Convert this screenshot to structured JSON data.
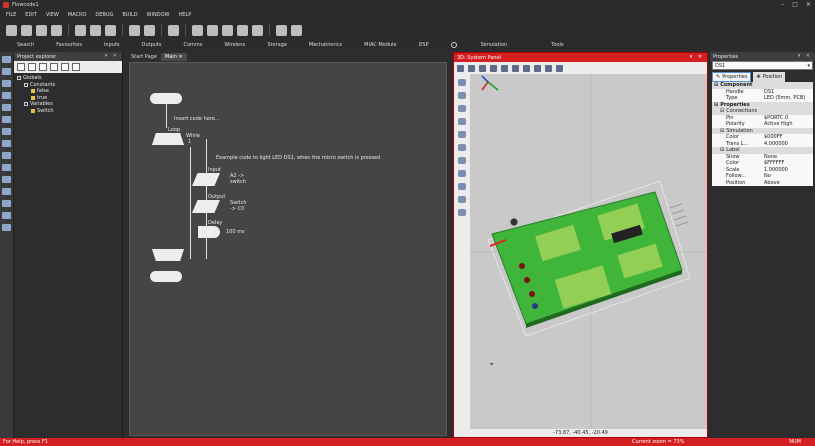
{
  "app": {
    "title": "Flowcode1"
  },
  "menu": [
    "FILE",
    "EDIT",
    "VIEW",
    "MACRO",
    "DEBUG",
    "BUILD",
    "WINDOW",
    "HELP"
  ],
  "ribbon_tabs": [
    "Search",
    "Favourites",
    "Inputs",
    "Outputs",
    "Comms",
    "Wireless",
    "Storage",
    "Mechatronics",
    "MIAC Module",
    "DSP",
    "Simulation",
    "Tools"
  ],
  "project_explorer": {
    "title": "Project explorer",
    "tree": [
      {
        "label": "Globals",
        "level": 0,
        "kind": "box"
      },
      {
        "label": "Constants",
        "level": 1,
        "kind": "box"
      },
      {
        "label": "false",
        "level": 2,
        "kind": "leaf"
      },
      {
        "label": "true",
        "level": 2,
        "kind": "leaf"
      },
      {
        "label": "Variables",
        "level": 1,
        "kind": "box"
      },
      {
        "label": "Switch",
        "level": 2,
        "kind": "leaf"
      }
    ]
  },
  "editor": {
    "tabs": [
      "Start Page",
      "Main"
    ],
    "flow": {
      "insert_code": "Insert code here...",
      "loop_label": "Loop",
      "while_label": "While",
      "while_cond": "1",
      "comment": "Example code to light LED DS1, when the micro switch is pressed",
      "input_label": "Input",
      "input_text1": "A2 ->",
      "input_text2": "switch",
      "output_label": "Output",
      "output_text1": "Switch",
      "output_text2": "-> C0",
      "delay_label": "Delay",
      "delay_text": "100 ms"
    }
  },
  "system_panel": {
    "title": "3D: System Panel",
    "coords": "-73.87, -40.45, -20.49"
  },
  "properties": {
    "title": "Properties",
    "selected": "DS1",
    "tabs": [
      "Properties",
      "Position"
    ],
    "rows": [
      {
        "type": "sec",
        "label": "Component"
      },
      {
        "type": "row",
        "key": "Handle",
        "val": "DS1"
      },
      {
        "type": "row",
        "key": "Type",
        "val": "LED (5mm, PCB)"
      },
      {
        "type": "sec",
        "label": "Properties"
      },
      {
        "type": "sec2",
        "label": "Connections"
      },
      {
        "type": "row",
        "key": "Pin",
        "val": "$PORTC.0"
      },
      {
        "type": "row",
        "key": "Polarity",
        "val": "Active High"
      },
      {
        "type": "sec2",
        "label": "Simulation"
      },
      {
        "type": "row",
        "key": "Color",
        "val": "$000FF"
      },
      {
        "type": "row",
        "key": "Trans L...",
        "val": "4.000000"
      },
      {
        "type": "sec2",
        "label": "Label"
      },
      {
        "type": "row",
        "key": "Show",
        "val": "None"
      },
      {
        "type": "row",
        "key": "Color",
        "val": "$FFFFFF"
      },
      {
        "type": "row",
        "key": "Scale",
        "val": "1.000000"
      },
      {
        "type": "row",
        "key": "Follow...",
        "val": "No"
      },
      {
        "type": "row",
        "key": "Position",
        "val": "Above"
      }
    ]
  },
  "status": {
    "help": "For Help, press F1",
    "zoom": "Current zoom = 73%",
    "num": "NUM"
  },
  "colors": {
    "accent": "#d42020",
    "pcb": "#3fb53a",
    "background": "#2d2d30"
  }
}
